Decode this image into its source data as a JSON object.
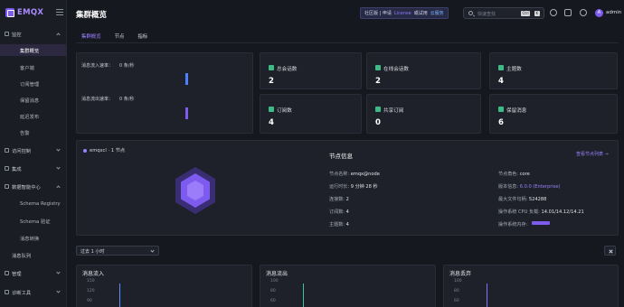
{
  "app": {
    "brand": "EMQX"
  },
  "header": {
    "title": "集群概览",
    "edition": {
      "part1": "社区版 | 申请",
      "license": "License",
      "part2": "或试用",
      "cloud": "云服务"
    },
    "search": {
      "placeholder": "快速查找",
      "key1": "Ctrl",
      "key2": "K"
    },
    "user": {
      "initial": "A",
      "name": "admin"
    },
    "icons": [
      "search-icon",
      "bell-icon",
      "gear-icon",
      "avatar"
    ]
  },
  "sidebar": {
    "items": [
      {
        "label": "监控",
        "expanded": true
      },
      {
        "label": "集群概览",
        "active": true
      },
      {
        "label": "客户端"
      },
      {
        "label": "订阅管理"
      },
      {
        "label": "保留消息"
      },
      {
        "label": "延迟发布"
      },
      {
        "label": "告警"
      },
      {
        "label": "访问控制"
      },
      {
        "label": "集成"
      },
      {
        "label": "数据智能中心",
        "expanded": true
      },
      {
        "label": "Schema Registry"
      },
      {
        "label": "Schema 验证"
      },
      {
        "label": "消息转换"
      },
      {
        "label": "消息队列"
      },
      {
        "label": "管理"
      },
      {
        "label": "诊断工具"
      }
    ]
  },
  "tabs": [
    {
      "label": "集群概览",
      "active": true
    },
    {
      "label": "节点"
    },
    {
      "label": "指标"
    }
  ],
  "rates": {
    "in": {
      "label": "消息流入速率：",
      "value": "0 条/秒",
      "color": "#4d7fff"
    },
    "out": {
      "label": "消息流出速率：",
      "value": "0 条/秒",
      "color": "#7e5bef"
    }
  },
  "stats": [
    {
      "label": "总会话数",
      "value": "2"
    },
    {
      "label": "在线会话数",
      "value": "2"
    },
    {
      "label": "主题数",
      "value": "4"
    },
    {
      "label": "订阅数",
      "value": "4"
    },
    {
      "label": "共享订阅",
      "value": "0"
    },
    {
      "label": "保留消息",
      "value": "6"
    }
  ],
  "node": {
    "header": "emqxcl · 1 节点",
    "title": "节点信息",
    "link": "查看节点列表 →",
    "left": {
      "name_k": "节点名称:",
      "name_v": "emqx@node",
      "uptime_k": "运行时长:",
      "uptime_v": "9 分钟 28 秒",
      "conn_k": "连接数:",
      "conn_v": "2",
      "subs_k": "订阅数:",
      "subs_v": "4",
      "topics_k": "主题数:",
      "topics_v": "4"
    },
    "right": {
      "role_k": "节点角色:",
      "role_v": "core",
      "ver_k": "版本信息:",
      "ver_v": "6.0.0 (Enterprise)",
      "files_k": "最大文件句柄:",
      "files_v": "524288",
      "cpu_k": "操作系统 CPU 负载:",
      "cpu_v": "14.01/14.12/14.21",
      "mem_k": "操作系统内存:"
    },
    "memory_fraction": 0.55,
    "accent": "#7e5bef"
  },
  "range": {
    "label": "过去 1 小时"
  },
  "charts": [
    {
      "title": "消息流入",
      "ticks": [
        "150",
        "120",
        "90"
      ]
    },
    {
      "title": "消息流出",
      "ticks": [
        "100",
        "80",
        "60"
      ]
    },
    {
      "title": "消息丢弃",
      "ticks": [
        "100",
        "80",
        "60"
      ]
    }
  ]
}
